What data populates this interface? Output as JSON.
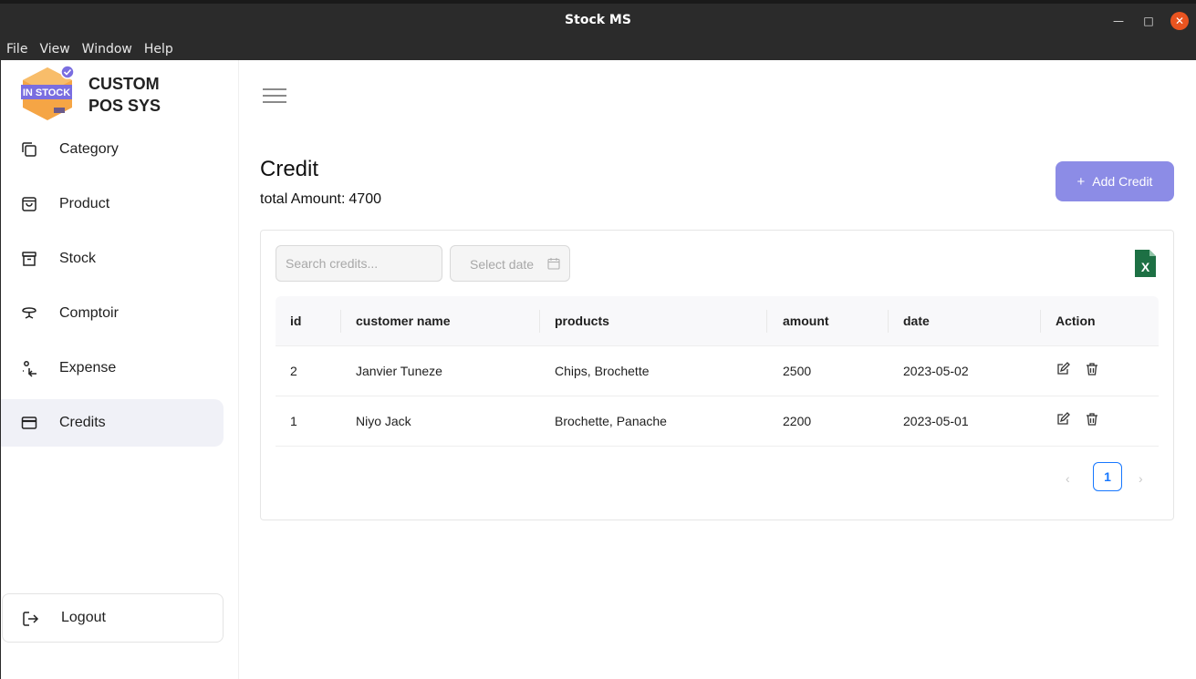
{
  "window": {
    "title": "Stock MS"
  },
  "menu": [
    "File",
    "View",
    "Window",
    "Help"
  ],
  "brand": {
    "line1": "CUSTOM",
    "line2": "POS SYS",
    "logo_text": "IN STOCK"
  },
  "sidebar": {
    "items": [
      {
        "label": "Category",
        "icon": "copy-icon"
      },
      {
        "label": "Product",
        "icon": "shopping-bag-icon"
      },
      {
        "label": "Stock",
        "icon": "archive-box-icon"
      },
      {
        "label": "Comptoir",
        "icon": "counter-icon"
      },
      {
        "label": "Expense",
        "icon": "expense-icon"
      },
      {
        "label": "Credits",
        "icon": "credit-card-icon",
        "active": true
      }
    ],
    "logout": "Logout"
  },
  "page": {
    "title": "Credit",
    "total_label": "total Amount:",
    "total_value": "4700",
    "add_button": "Add Credit",
    "add_icon": "+"
  },
  "filters": {
    "search_placeholder": "Search credits...",
    "date_placeholder": "Select date"
  },
  "table": {
    "headers": [
      "id",
      "customer name",
      "products",
      "amount",
      "date",
      "Action"
    ],
    "rows": [
      {
        "id": "2",
        "customer": "Janvier Tuneze",
        "products": "Chips, Brochette",
        "amount": "2500",
        "date": "2023-05-02"
      },
      {
        "id": "1",
        "customer": "Niyo Jack",
        "products": "Brochette, Panache",
        "amount": "2200",
        "date": "2023-05-01"
      }
    ]
  },
  "pagination": {
    "current": "1",
    "prev": "‹",
    "next": "›"
  },
  "colors": {
    "accent": "#8c8ce6",
    "active_nav": "#f0f1f7",
    "page_border": "#1677ff",
    "excel": "#1d7044"
  }
}
